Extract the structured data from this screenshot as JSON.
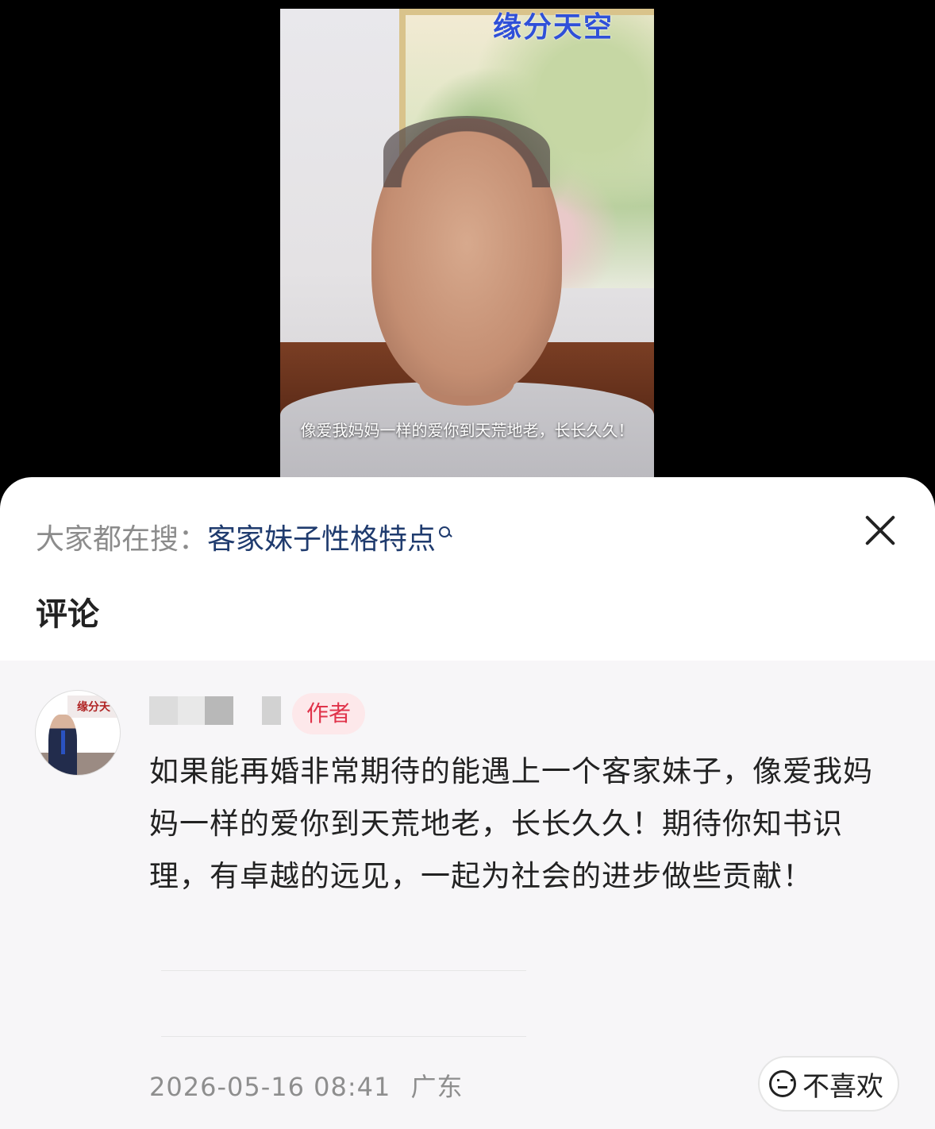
{
  "video": {
    "logo_text": "缘分天空",
    "caption": "像爱我妈妈一样的爱你到天荒地老，长长久久！"
  },
  "search_hint": {
    "prefix": "大家都在搜：",
    "term": "客家妹子性格特点",
    "icon": "search-icon"
  },
  "close_icon": "close-icon",
  "section_title": "评论",
  "comment": {
    "avatar_text": "缘分天",
    "author_badge": "作者",
    "text": "如果能再婚非常期待的能遇上一个客家妹子，像爱我妈妈一样的爱你到天荒地老，长长久久！期待你知书识理，有卓越的远见，一起为社会的进步做些贡献！",
    "date": "2026-05-16 08:41",
    "location": "广东",
    "dislike_label": "不喜欢",
    "dislike_icon": "frown-face-icon"
  },
  "colors": {
    "search_term": "#1f3b6e",
    "badge_text": "#e0334a",
    "badge_bg": "#fde8ea",
    "comment_bg": "#f7f6f8"
  }
}
